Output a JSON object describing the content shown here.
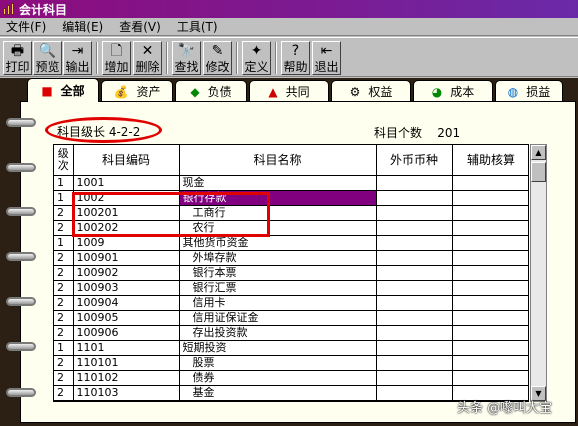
{
  "window": {
    "title": "会计科目"
  },
  "menu": [
    "文件(F)",
    "编辑(E)",
    "查看(V)",
    "工具(T)"
  ],
  "toolbar": {
    "print": "打印",
    "preview": "预览",
    "export": "输出",
    "add": "增加",
    "delete": "删除",
    "find": "查找",
    "modify": "修改",
    "define": "定义",
    "help": "帮助",
    "exit": "退出"
  },
  "tabs": [
    "全部",
    "资产",
    "负债",
    "共同",
    "权益",
    "成本",
    "损益"
  ],
  "info": {
    "level": "科目级长  4-2-2",
    "count_label": "科目个数",
    "count": "201"
  },
  "grid": {
    "columns": [
      "级次",
      "科目编码",
      "科目名称",
      "外币币种",
      "辅助核算"
    ],
    "rows": [
      {
        "level": "1",
        "code": "1001",
        "name": "现金"
      },
      {
        "level": "1",
        "code": "1002",
        "name": "银行存款"
      },
      {
        "level": "2",
        "code": "100201",
        "name": "工商行"
      },
      {
        "level": "2",
        "code": "100202",
        "name": "农行"
      },
      {
        "level": "1",
        "code": "1009",
        "name": "其他货币资金"
      },
      {
        "level": "2",
        "code": "100901",
        "name": "外埠存款"
      },
      {
        "level": "2",
        "code": "100902",
        "name": "银行本票"
      },
      {
        "level": "2",
        "code": "100903",
        "name": "银行汇票"
      },
      {
        "level": "2",
        "code": "100904",
        "name": "信用卡"
      },
      {
        "level": "2",
        "code": "100905",
        "name": "信用证保证金"
      },
      {
        "level": "2",
        "code": "100906",
        "name": "存出投资款"
      },
      {
        "level": "1",
        "code": "1101",
        "name": "短期投资"
      },
      {
        "level": "2",
        "code": "110101",
        "name": "股票"
      },
      {
        "level": "2",
        "code": "110102",
        "name": "债券"
      },
      {
        "level": "2",
        "code": "110103",
        "name": "基金"
      }
    ],
    "selected_row": 1
  },
  "watermark": "头条 @嚟叫大宝",
  "colors": {
    "title_bar": "#8c0c7c",
    "selection": "#800080",
    "annotation": "#e00000"
  }
}
